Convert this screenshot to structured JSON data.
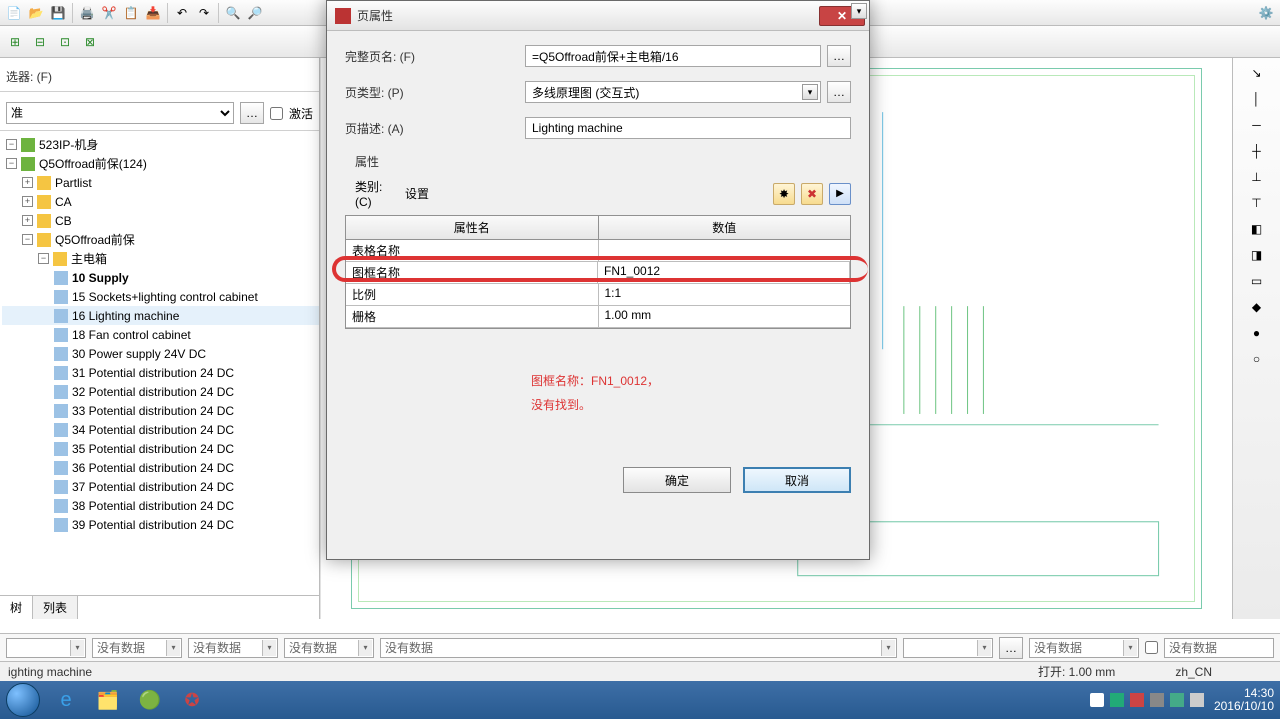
{
  "toolbar": {
    "filter_label": "选器: (F)",
    "filter_value": "准",
    "activate_label": "激活"
  },
  "tree": {
    "root1": "523IP-机身",
    "root2": "Q5Offroad前保(124)",
    "partlist": "Partlist",
    "ca": "CA",
    "cb": "CB",
    "q5": "Q5Offroad前保",
    "zhu": "主电箱",
    "pages": [
      "10 Supply",
      "15 Sockets+lighting control cabinet",
      "16 Lighting machine",
      "18 Fan control cabinet",
      "30 Power supply 24V DC",
      "31 Potential distribution 24 DC",
      "32 Potential distribution 24 DC",
      "33 Potential distribution 24 DC",
      "34 Potential distribution 24 DC",
      "35 Potential distribution 24 DC",
      "36 Potential distribution 24 DC",
      "37 Potential distribution 24 DC",
      "38 Potential distribution 24 DC",
      "39 Potential distribution 24 DC"
    ]
  },
  "tabs": {
    "tree": "树",
    "list": "列表"
  },
  "dialog": {
    "title": "页属性",
    "full_page_label": "完整页名: (F)",
    "full_page_value": "=Q5Offroad前保+主电箱/16",
    "page_type_label": "页类型: (P)",
    "page_type_value": "多线原理图 (交互式)",
    "page_desc_label": "页描述: (A)",
    "page_desc_value": "Lighting machine",
    "props_label": "属性",
    "category_label": "类别: (C)",
    "category_value": "设置",
    "head_name": "属性名",
    "head_value": "数值",
    "rows": [
      {
        "n": "表格名称",
        "v": ""
      },
      {
        "n": "图框名称",
        "v": "FN1_0012"
      },
      {
        "n": "比例",
        "v": "1:1"
      },
      {
        "n": "栅格",
        "v": "1.00 mm"
      }
    ],
    "annot1": "图框名称：FN1_0012，",
    "annot2": "没有找到。",
    "ok": "确定",
    "cancel": "取消"
  },
  "status_combos": {
    "nodata": "没有数据"
  },
  "statusbar": {
    "left": "ighting machine",
    "open": "打开: 1.00 mm",
    "locale": "zh_CN"
  },
  "taskbar": {
    "time": "14:30",
    "date": "2016/10/10"
  }
}
